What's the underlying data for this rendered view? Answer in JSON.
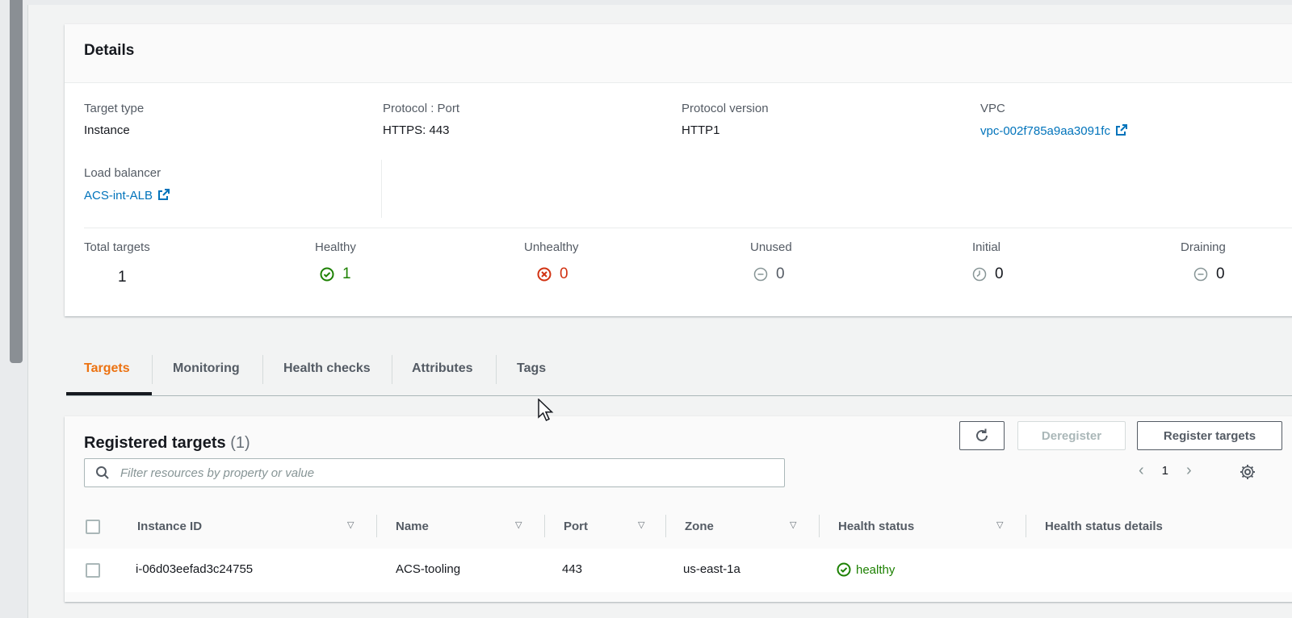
{
  "details": {
    "title": "Details",
    "target_type": {
      "label": "Target type",
      "value": "Instance"
    },
    "protocol_port": {
      "label": "Protocol : Port",
      "value": "HTTPS: 443"
    },
    "protocol_version": {
      "label": "Protocol version",
      "value": "HTTP1"
    },
    "vpc": {
      "label": "VPC",
      "value": "vpc-002f785a9aa3091fc"
    },
    "load_balancer": {
      "label": "Load balancer",
      "value": "ACS-int-ALB"
    },
    "stats": {
      "total": {
        "label": "Total targets",
        "value": "1"
      },
      "healthy": {
        "label": "Healthy",
        "value": "1"
      },
      "unhealthy": {
        "label": "Unhealthy",
        "value": "0"
      },
      "unused": {
        "label": "Unused",
        "value": "0"
      },
      "initial": {
        "label": "Initial",
        "value": "0"
      },
      "draining": {
        "label": "Draining",
        "value": "0"
      }
    }
  },
  "tabs": {
    "targets": "Targets",
    "monitoring": "Monitoring",
    "health_checks": "Health checks",
    "attributes": "Attributes",
    "tags": "Tags",
    "active": "Targets"
  },
  "registered": {
    "title": "Registered targets",
    "count": "(1)",
    "deregister_label": "Deregister",
    "register_label": "Register targets",
    "search_placeholder": "Filter resources by property or value",
    "page": "1",
    "columns": {
      "instance_id": "Instance ID",
      "name": "Name",
      "port": "Port",
      "zone": "Zone",
      "health_status": "Health status",
      "health_status_details": "Health status details"
    },
    "rows": [
      {
        "instance_id": "i-06d03eefad3c24755",
        "name": "ACS-tooling",
        "port": "443",
        "zone": "us-east-1a",
        "health_status": "healthy",
        "health_status_details": ""
      }
    ]
  },
  "colors": {
    "link": "#0073bb",
    "active_tab": "#ec7211",
    "healthy": "#1d8102",
    "unhealthy": "#d13212",
    "neutral": "#879596"
  },
  "icons": [
    "external-link-icon",
    "check-circle-icon",
    "x-circle-icon",
    "minus-circle-icon",
    "clock-icon",
    "refresh-icon",
    "search-icon",
    "chevron-left-icon",
    "chevron-right-icon",
    "settings-gear-icon",
    "sort-caret-icon",
    "mouse-cursor-icon"
  ]
}
